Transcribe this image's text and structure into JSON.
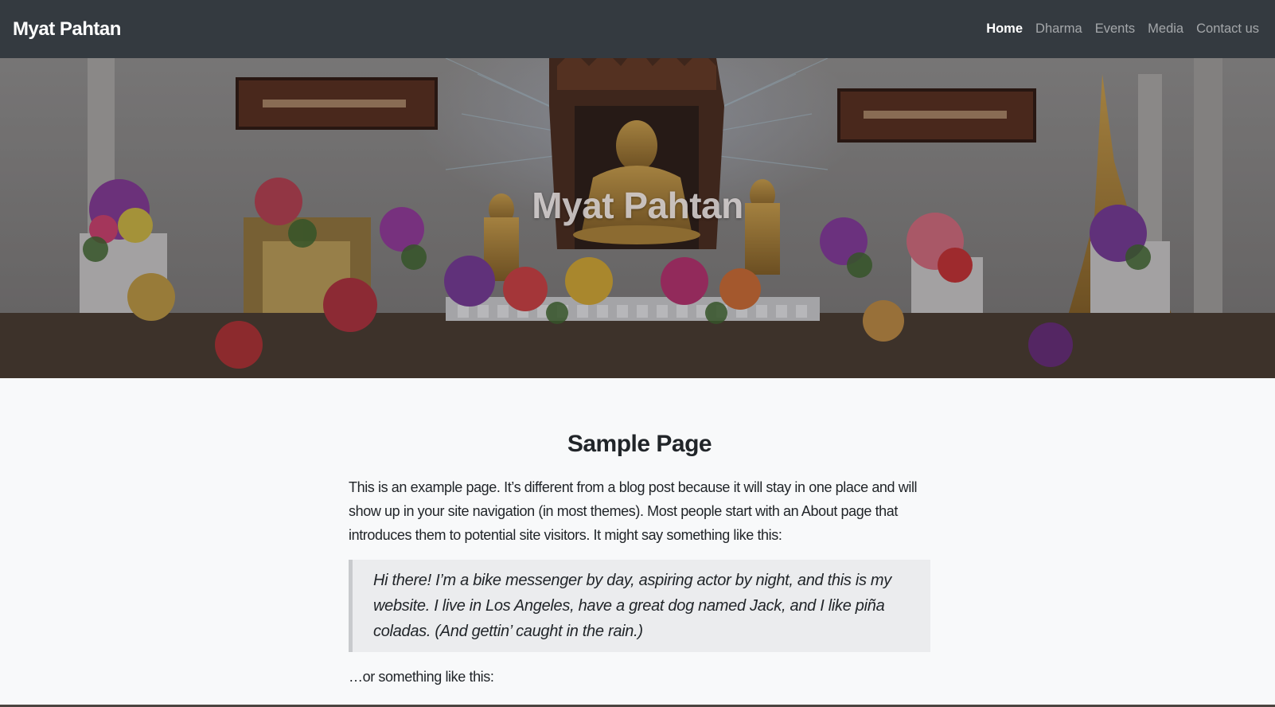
{
  "navbar": {
    "brand": "Myat Pahtan",
    "links": [
      {
        "label": "Home"
      },
      {
        "label": "Dharma"
      },
      {
        "label": "Events"
      },
      {
        "label": "Media"
      },
      {
        "label": "Contact us"
      }
    ],
    "active_link": "Home",
    "background": "#343a40"
  },
  "hero": {
    "title": "Myat Pahtan"
  },
  "main": {
    "title": "Sample Page",
    "intro": "This is an example page. It’s different from a blog post because it will stay in one place and will show up in your site navigation (in most themes). Most people start with an About page that introduces them to potential site visitors. It might say something like this:",
    "quote": "Hi there! I’m a bike messenger by day, aspiring actor by night, and this is my website. I live in Los Angeles, have a great dog named Jack, and I like piña coladas. (And gettin’ caught in the rain.)",
    "outro": "…or something like this:"
  }
}
